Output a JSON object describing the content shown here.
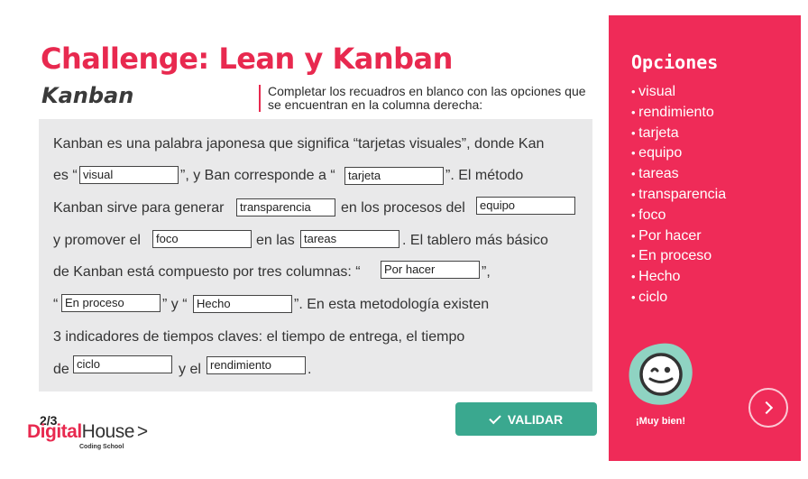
{
  "header": {
    "title": "Challenge: Lean y Kanban",
    "subtitle": "Kanban",
    "instructions": "Completar los recuadros en blanco con las opciones que se encuentran en la columna derecha:"
  },
  "exercise": {
    "t1": "Kanban es una palabra japonesa que significa “tarjetas visuales”, donde Kan",
    "t2a": "es “",
    "t2b": "”, y Ban corresponde a “",
    "t2c": "”. El método",
    "t3a": "Kanban sirve para generar",
    "t3b": "en los procesos del",
    "t4a": "y promover el",
    "t4b": "en las",
    "t4c": ". El tablero más básico",
    "t5a": "de Kanban está compuesto por tres columnas: “",
    "t5b": "”,",
    "t6a": "“",
    "t6b": "” y “",
    "t6c": "”. En esta metodología existen",
    "t7": "3 indicadores de tiempos claves: el tiempo de  entrega, el tiempo",
    "t8a": "de",
    "t8b": "y el",
    "t8c": ".",
    "blanks": {
      "b1": "visual",
      "b2": "tarjeta",
      "b3": "transparencia",
      "b4": "equipo",
      "b5": "foco",
      "b6": "tareas",
      "b7": "Por hacer",
      "b8": "En proceso",
      "b9": "Hecho",
      "b10": "ciclo",
      "b11": "rendimiento"
    }
  },
  "validate_label": "VALIDAR",
  "page_indicator": "2/3",
  "logo": {
    "digital": "Digital",
    "house": "House",
    "arrow": ">",
    "tagline": "Coding School"
  },
  "panel": {
    "title": "Opciones",
    "options": [
      "visual",
      "rendimiento",
      "tarjeta",
      "equipo",
      "tareas",
      "transparencia",
      "foco",
      "Por hacer",
      "En proceso",
      "Hecho",
      "ciclo"
    ],
    "praise": "¡Muy bien!",
    "mascot_icon": "winking-face-icon",
    "next_icon": "chevron-right-icon"
  },
  "colors": {
    "accent": "#ef2b58",
    "title": "#e8294f",
    "button": "#3aa88f",
    "exercise_bg": "#e9e9ea"
  }
}
